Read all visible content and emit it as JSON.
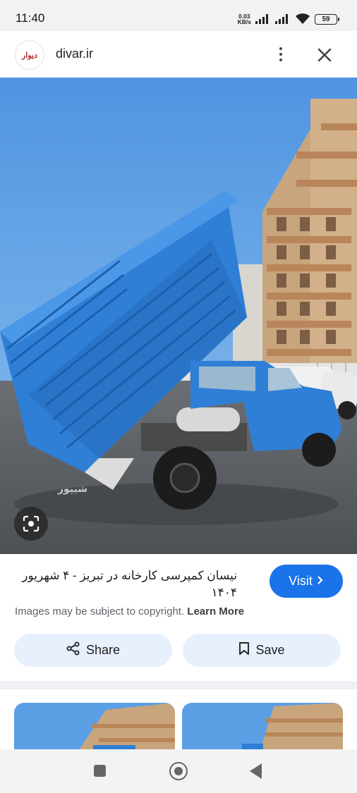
{
  "status_bar": {
    "time": "11:40",
    "net_speed_value": "0.03",
    "net_speed_unit": "KB/s",
    "battery": "59"
  },
  "header": {
    "site_name": "divar.ir",
    "logo_text": "دیوار",
    "more_icon": "more-vert-icon",
    "close_icon": "close-icon"
  },
  "image": {
    "watermark": "شیپور",
    "lens_icon": "lens-icon"
  },
  "result": {
    "title": "نیسان کمپرسی کارخانه در تبریز - ۴ شهریور ۱۴۰۴",
    "visit_label": "Visit",
    "copyright_text": "Images may be subject to copyright.",
    "learn_more": "Learn More",
    "share_label": "Share",
    "save_label": "Save"
  },
  "colors": {
    "accent": "#1a73e8",
    "action_button_bg": "#e8f0fe",
    "truck_blue": "#2f7fd6",
    "sky": "#5aa0e6"
  }
}
